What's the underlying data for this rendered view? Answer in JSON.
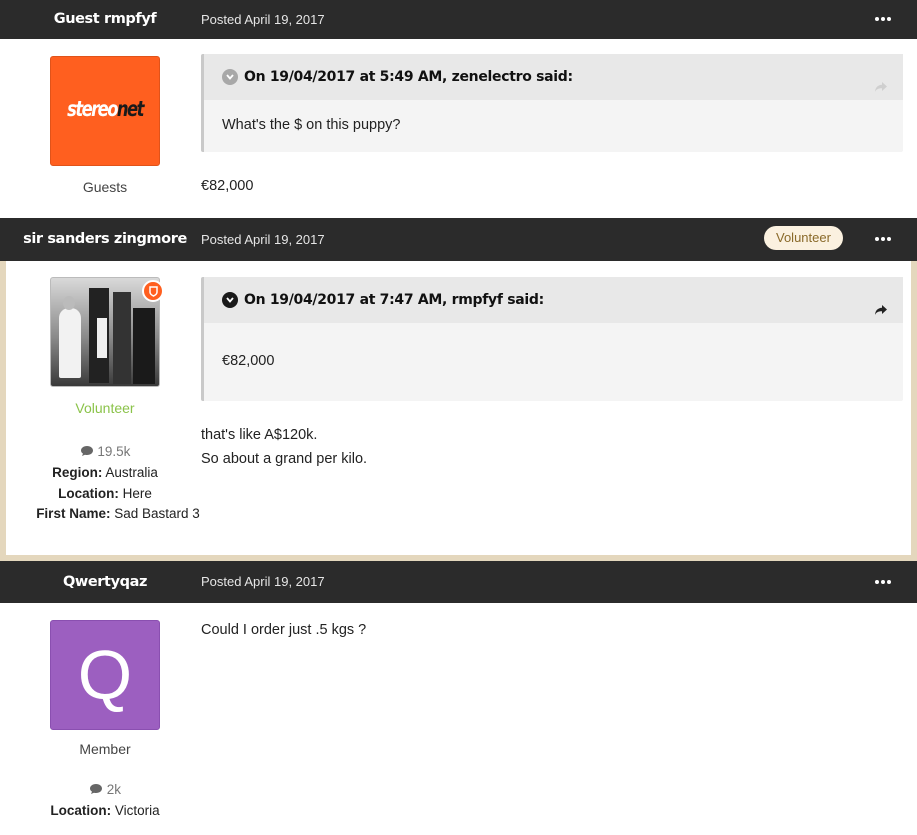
{
  "posts": [
    {
      "author": "Guest rmpfyf",
      "posted": "Posted April 19, 2017",
      "avatar": {
        "type": "logo",
        "text_a": "stereo",
        "text_b": "net",
        "bg": "#ff5f1f"
      },
      "group": "Guests",
      "quote": {
        "citation": "On 19/04/2017 at 5:49 AM, zenelectro said:",
        "text": "What's the $ on this puppy?"
      },
      "content": [
        "€82,000"
      ]
    },
    {
      "author": "sir sanders zingmore",
      "posted": "Posted April 19, 2017",
      "badge": "Volunteer",
      "avatar": {
        "type": "photo"
      },
      "group": "Volunteer",
      "group_color": "#8bc34a",
      "post_count": "19.5k",
      "fields": [
        {
          "label": "Region:",
          "value": "Australia"
        },
        {
          "label": "Location:",
          "value": "Here"
        },
        {
          "label": "First Name:",
          "value": "Sad Bastard 3"
        }
      ],
      "quote": {
        "citation": "On 19/04/2017 at 7:47 AM, rmpfyf said:",
        "text": "€82,000"
      },
      "content": [
        "that's like A$120k.",
        "So about a grand per kilo."
      ]
    },
    {
      "author": "Qwertyqaz",
      "posted": "Posted April 19, 2017",
      "avatar": {
        "type": "letter",
        "letter": "Q",
        "bg": "#9c5fc0"
      },
      "group": "Member",
      "post_count": "2k",
      "fields": [
        {
          "label": "Location:",
          "value": "Victoria"
        }
      ],
      "content": [
        "Could I order just .5 kgs ?"
      ]
    }
  ],
  "colors": {
    "header_bg": "#2b2b2b",
    "highlight_border": "#e4d7bd",
    "accent_orange": "#ff5f1f"
  },
  "icons": [
    "more-icon",
    "chevron-down-icon",
    "share-icon",
    "comment-icon",
    "shield-badge-icon"
  ]
}
